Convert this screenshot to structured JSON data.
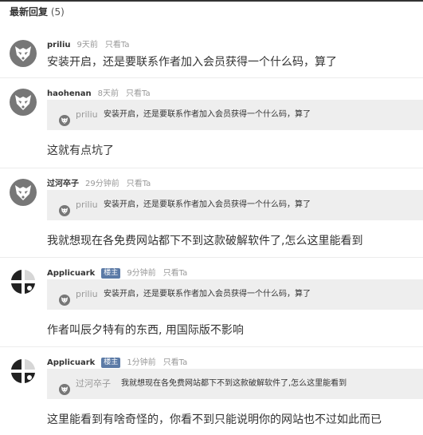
{
  "header": {
    "title": "最新回复",
    "count": "(5)"
  },
  "replies": [
    {
      "user": "priliu",
      "badge": "",
      "time": "9天前",
      "only_ta": "只看Ta",
      "avatar": "fox-avatar",
      "quote": null,
      "content": "安装开启，还是要联系作者加入会员获得一个什么码，算了"
    },
    {
      "user": "haohenan",
      "badge": "",
      "time": "8天前",
      "only_ta": "只看Ta",
      "avatar": "fox-avatar",
      "quote": {
        "user": "priliu",
        "text": "安装开启，还是要联系作者加入会员获得一个什么码，算了"
      },
      "content": "这就有点坑了"
    },
    {
      "user": "过河卒子",
      "badge": "",
      "time": "29分钟前",
      "only_ta": "只看Ta",
      "avatar": "fox-avatar",
      "quote": {
        "user": "priliu",
        "text": "安装开启，还是要联系作者加入会员获得一个什么码，算了"
      },
      "content": "我就想现在各免费网站都下不到这款破解软件了,怎么这里能看到"
    },
    {
      "user": "Applicuark",
      "badge": "楼主",
      "time": "9分钟前",
      "only_ta": "只看Ta",
      "avatar": "logo-avatar",
      "quote": {
        "user": "priliu",
        "text": "安装开启，还是要联系作者加入会员获得一个什么码，算了"
      },
      "content": "作者叫辰夕特有的东西, 用国际版不影响"
    },
    {
      "user": "Applicuark",
      "badge": "楼主",
      "time": "1分钟前",
      "only_ta": "只看Ta",
      "avatar": "logo-avatar",
      "quote": {
        "user": "过河卒子",
        "text": "我就想现在各免费网站都下不到这款破解软件了,怎么这里能看到"
      },
      "content": "这里能看到有啥奇怪的，你看不到只能说明你的网站也不过如此而已"
    }
  ]
}
